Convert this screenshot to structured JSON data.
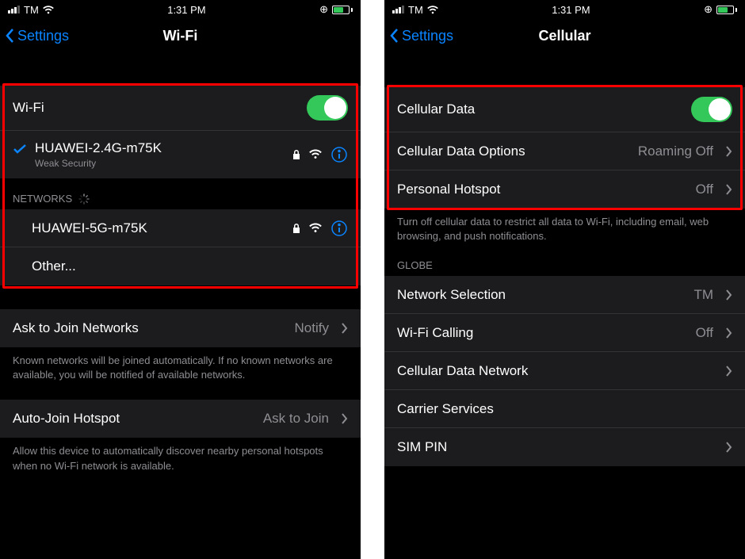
{
  "left": {
    "status": {
      "carrier": "TM",
      "time": "1:31 PM"
    },
    "nav": {
      "back": "Settings",
      "title": "Wi-Fi"
    },
    "wifi_label": "Wi-Fi",
    "connected": {
      "ssid": "HUAWEI-2.4G-m75K",
      "warning": "Weak Security"
    },
    "networks_header": "NETWORKS",
    "networks": [
      {
        "ssid": "HUAWEI-5G-m75K"
      }
    ],
    "other_label": "Other...",
    "ask_join": {
      "label": "Ask to Join Networks",
      "value": "Notify"
    },
    "ask_join_footer": "Known networks will be joined automatically. If no known networks are available, you will be notified of available networks.",
    "auto_hotspot": {
      "label": "Auto-Join Hotspot",
      "value": "Ask to Join"
    },
    "auto_hotspot_footer": "Allow this device to automatically discover nearby personal hotspots when no Wi-Fi network is available."
  },
  "right": {
    "status": {
      "carrier": "TM",
      "time": "1:31 PM"
    },
    "nav": {
      "back": "Settings",
      "title": "Cellular"
    },
    "cellular_data_label": "Cellular Data",
    "cd_options": {
      "label": "Cellular Data Options",
      "value": "Roaming Off"
    },
    "hotspot": {
      "label": "Personal Hotspot",
      "value": "Off"
    },
    "cd_footer": "Turn off cellular data to restrict all data to Wi-Fi, including email, web browsing, and push notifications.",
    "globe_header": "GLOBE",
    "net_sel": {
      "label": "Network Selection",
      "value": "TM"
    },
    "wifi_calling": {
      "label": "Wi-Fi Calling",
      "value": "Off"
    },
    "cd_network": {
      "label": "Cellular Data Network"
    },
    "carrier_services": "Carrier Services",
    "sim_pin": "SIM PIN"
  }
}
